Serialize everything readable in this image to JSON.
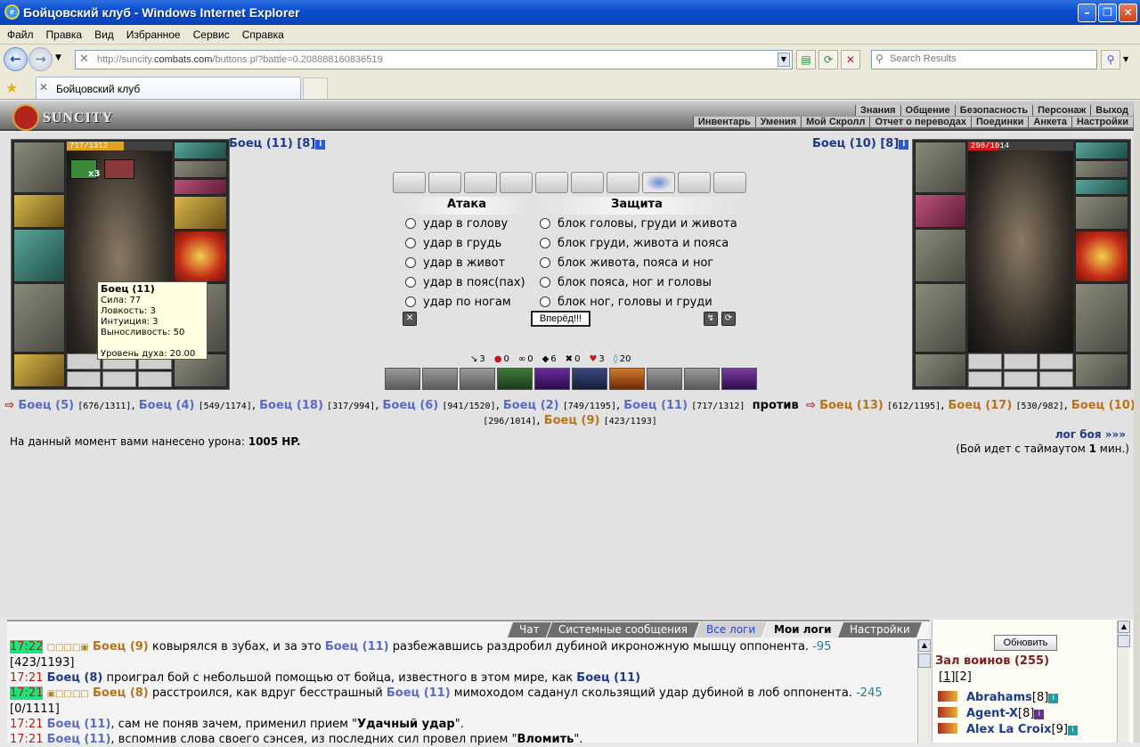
{
  "window": {
    "title": "Бойцовский клуб - Windows Internet Explorer"
  },
  "menu": [
    "Файл",
    "Правка",
    "Вид",
    "Избранное",
    "Сервис",
    "Справка"
  ],
  "address": {
    "prefix": "http://suncity.",
    "domain": "combats.com",
    "path": "/buttons.pl?battle=0.208888160836519"
  },
  "search": {
    "placeholder": "Search Results"
  },
  "tab": {
    "title": "Бойцовский клуб"
  },
  "game": {
    "logo": "SUNCITY",
    "menu_top": [
      "Знания",
      "Общение",
      "Безопасность",
      "Персонаж",
      "Выход"
    ],
    "menu_bottom": [
      "Инвентарь",
      "Умения",
      "Мой Скролл",
      "Отчет о переводах",
      "Поединки",
      "Анкета",
      "Настройки"
    ]
  },
  "left_fighter": {
    "name": "Боец (11)",
    "level": "[8]",
    "hp": "717/1312",
    "hp_fraction": 0.546,
    "badge": "x3"
  },
  "right_fighter": {
    "name": "Боец (10)",
    "level": "[8]",
    "hp": "296/1014",
    "hp_fraction": 0.292
  },
  "tooltip": {
    "title": "Боец (11)",
    "lines": [
      "Сила: 77",
      "Ловкость: 3",
      "Интуиция: 3",
      "Выносливость: 50"
    ],
    "spirit": "Уровень духа: 20.00"
  },
  "attack": {
    "header": "Атака",
    "options": [
      "удар в голову",
      "удар в грудь",
      "удар в живот",
      "удар в пояс(пах)",
      "удар по ногам"
    ]
  },
  "defense": {
    "header": "Защита",
    "options": [
      "блок головы, груди и живота",
      "блок груди, живота и пояса",
      "блок живота, пояса и ног",
      "блок пояса, ног и головы",
      "блок ног, головы и груди"
    ]
  },
  "forward_button": "Вперёд!!!",
  "stats": [
    {
      "icon": "sword-icon",
      "glyph": "↘",
      "value": "3"
    },
    {
      "icon": "blood-icon",
      "glyph": "●",
      "value": "0"
    },
    {
      "icon": "chain-icon",
      "glyph": "∞",
      "value": "0"
    },
    {
      "icon": "shield-icon",
      "glyph": "◆",
      "value": "6"
    },
    {
      "icon": "cross-icon",
      "glyph": "✖",
      "value": "0"
    },
    {
      "icon": "heart-icon",
      "glyph": "♥",
      "value": "3"
    },
    {
      "icon": "spirit-icon",
      "glyph": "◊",
      "value": "20"
    }
  ],
  "teams": {
    "team1": [
      {
        "name": "Боец (5)",
        "hp": "[676/1311]"
      },
      {
        "name": "Боец (4)",
        "hp": "[549/1174]"
      },
      {
        "name": "Боец (18)",
        "hp": "[317/994]"
      },
      {
        "name": "Боец (6)",
        "hp": "[941/1520]"
      },
      {
        "name": "Боец (2)",
        "hp": "[749/1195]"
      },
      {
        "name": "Боец (11)",
        "hp": "[717/1312]"
      }
    ],
    "versus": "против",
    "team2": [
      {
        "name": "Боец (13)",
        "hp": "[612/1195]"
      },
      {
        "name": "Боец (17)",
        "hp": "[530/982]"
      },
      {
        "name": "Боец (10)",
        "hp": "[296/1014]"
      },
      {
        "name": "Боец (9)",
        "hp": "[423/1193]"
      }
    ]
  },
  "damage": {
    "text": "На данный момент вами нанесено урона:",
    "value": "1005 HP."
  },
  "log_link": "лог боя »»»",
  "timeout": {
    "pre": "(Бой идет с таймаутом ",
    "value": "1",
    "post": " мин.)"
  },
  "chat_tabs": [
    "Чат",
    "Системные сообщения",
    "Все логи",
    "Мои логи",
    "Настройки"
  ],
  "chat": [
    {
      "time": "17:22",
      "marks": "□□□□▣",
      "a": "Боец (9)",
      "t1": " ковырялся в зубах, и за это ",
      "b": "Боец (11)",
      "t2": " разбежавшись раздробил дубиной икроножную мышцу оппонента.",
      "dmg": " -95",
      "hp": "[423/1193]"
    },
    {
      "time": "17:21",
      "a": "Боец (8)",
      "t1": " проиграл бой с небольшой помощью от бойца, известного в этом мире, как ",
      "b": "Боец (11)"
    },
    {
      "time": "17:21",
      "marks": "▣□□□□",
      "a": "Боец (8)",
      "t1": " расстроился, как вдруг бесстрашный ",
      "b": "Боец (11)",
      "t2": " мимоходом саданул скользящий удар дубиной в лоб оппонента.",
      "dmg": " -245",
      "hp": "[0/1111]"
    },
    {
      "time": "17:21",
      "a": "Боец (11)",
      "t1": ", сам не поняв зачем, применил прием \"",
      "q": "Удачный удар",
      "t2": "\"."
    },
    {
      "time": "17:21",
      "a": "Боец (11)",
      "t1": ", вспомнив слова своего сэнсея, из последних сил провел прием \"",
      "q": "Вломить",
      "t2": "\"."
    }
  ],
  "room": {
    "refresh": "Обновить",
    "title": "Зал воинов (255)",
    "pages": [
      "1",
      "2"
    ],
    "players": [
      {
        "name": "Abrahams",
        "level": "[8]"
      },
      {
        "name": "Agent-X",
        "level": "[8]"
      },
      {
        "name": "Alex La Croix",
        "level": "[9]"
      }
    ]
  }
}
